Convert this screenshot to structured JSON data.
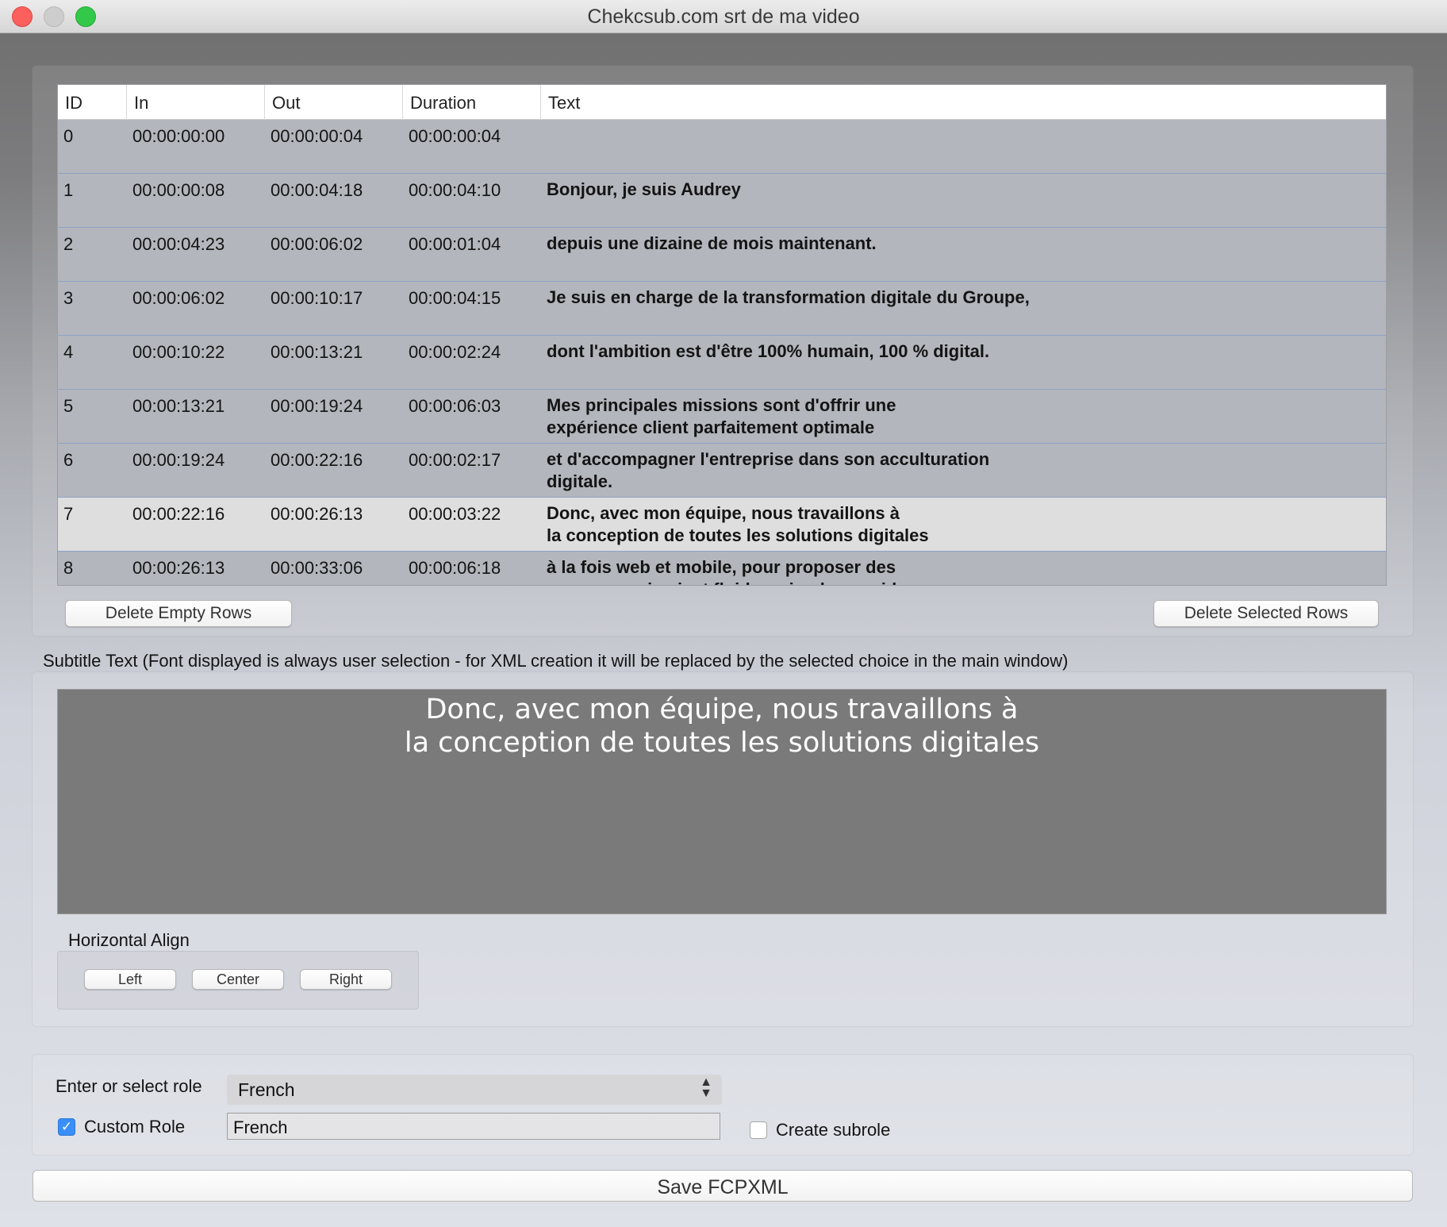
{
  "window": {
    "title": "Chekcsub.com srt de ma video"
  },
  "table": {
    "headers": [
      "ID",
      "In",
      "Out",
      "Duration",
      "Text"
    ],
    "rows": [
      {
        "id": "0",
        "in": "00:00:00:00",
        "out": "00:00:00:04",
        "duration": "00:00:00:04",
        "text": ""
      },
      {
        "id": "1",
        "in": "00:00:00:08",
        "out": "00:00:04:18",
        "duration": "00:00:04:10",
        "text": "Bonjour, je suis Audrey"
      },
      {
        "id": "2",
        "in": "00:00:04:23",
        "out": "00:00:06:02",
        "duration": "00:00:01:04",
        "text": "depuis une dizaine de mois maintenant."
      },
      {
        "id": "3",
        "in": "00:00:06:02",
        "out": "00:00:10:17",
        "duration": "00:00:04:15",
        "text": "Je suis en charge de la transformation digitale du Groupe,"
      },
      {
        "id": "4",
        "in": "00:00:10:22",
        "out": "00:00:13:21",
        "duration": "00:00:02:24",
        "text": "dont l'ambition est d'être 100% humain, 100 % digital."
      },
      {
        "id": "5",
        "in": "00:00:13:21",
        "out": "00:00:19:24",
        "duration": "00:00:06:03",
        "text": "Mes principales missions sont d'offrir une\nexpérience client parfaitement optimale"
      },
      {
        "id": "6",
        "in": "00:00:19:24",
        "out": "00:00:22:16",
        "duration": "00:00:02:17",
        "text": "et d'accompagner l'entreprise dans son acculturation\ndigitale."
      },
      {
        "id": "7",
        "in": "00:00:22:16",
        "out": "00:00:26:13",
        "duration": "00:00:03:22",
        "text": "Donc, avec mon équipe, nous travaillons à\nla conception de toutes les solutions digitales",
        "selected": true
      },
      {
        "id": "8",
        "in": "00:00:26:13",
        "out": "00:00:33:06",
        "duration": "00:00:06:18",
        "text": "à la fois web et mobile, pour proposer des\nparcours qui soient fluides, simples, rapides"
      }
    ]
  },
  "buttons": {
    "delete_empty": "Delete Empty Rows",
    "delete_selected": "Delete Selected Rows",
    "align_left": "Left",
    "align_center": "Center",
    "align_right": "Right",
    "save": "Save FCPXML"
  },
  "subtitle": {
    "label": "Subtitle Text (Font displayed is always user selection - for XML creation it will be replaced by the selected choice in the main window)",
    "preview_text": "Donc, avec mon équipe, nous travaillons à\nla conception de toutes les solutions digitales"
  },
  "align": {
    "label": "Horizontal Align"
  },
  "role": {
    "select_label": "Enter or select role",
    "select_value": "French",
    "custom_label": "Custom Role",
    "custom_checked": true,
    "custom_value": "French",
    "subrole_label": "Create subrole",
    "subrole_checked": false
  },
  "colors": {
    "selection_row": "#dedede",
    "row_bg": "#b3b6bc",
    "checkbox_accent": "#3a8ef7",
    "preview_bg": "#7a7a7a"
  }
}
